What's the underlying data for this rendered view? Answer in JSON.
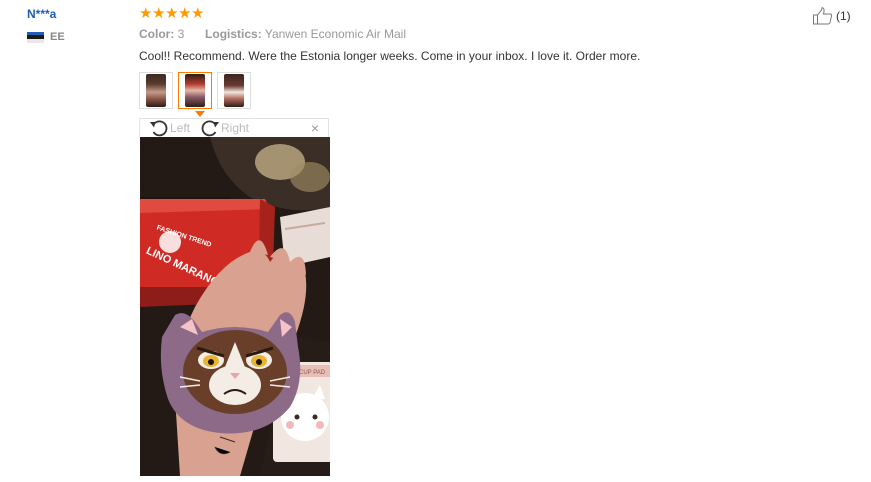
{
  "review": {
    "user_name": "N***a",
    "country_code": "EE",
    "rating": 5,
    "color_label": "Color:",
    "color_value": "3",
    "logistics_label": "Logistics:",
    "logistics_value": "Yanwen Economic Air Mail",
    "text": "Cool!! Recommend. Were the Estonia longer weeks. Come in your inbox. I love it. Order more.",
    "helpful_count": "(1)"
  },
  "viewer": {
    "rotate_left_label": "Left",
    "rotate_right_label": "Right",
    "close_symbol": "×",
    "active_index": 1,
    "thumbnail_count": 3
  },
  "photo_text": {
    "box_line1": "FASHION TREND",
    "box_line2": "LINO MARANO",
    "card_text": "CUTE CUP PAD"
  },
  "colors": {
    "star": "#ff9a00",
    "username": "#1a5eb8",
    "active_border": "#ff7a00",
    "flag": [
      "#1f5fb5",
      "#1a1a1a",
      "#ffffff"
    ]
  }
}
